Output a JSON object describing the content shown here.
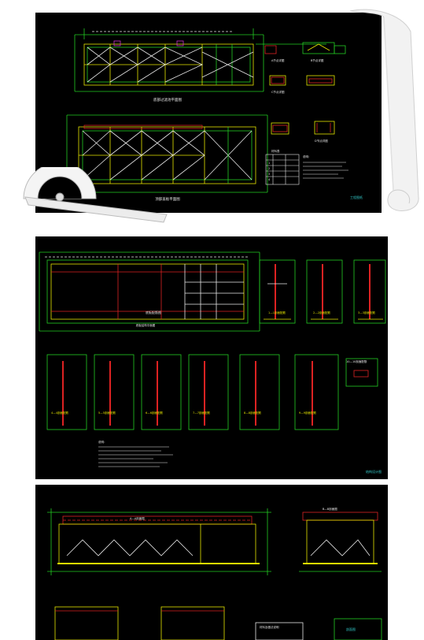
{
  "sheet1": {
    "plan_title_top": "底部过滤池平面图",
    "plan_title_bottom": "顶部盖板平面图",
    "table_title": "材料表",
    "table_rows": [
      "1",
      "2",
      "3",
      "4"
    ],
    "notes_title": "说明：",
    "detail_labels": [
      "A节点详图",
      "B节点详图",
      "C节点详图",
      "D节点详图"
    ],
    "stamp": "工程图纸"
  },
  "sheet2": {
    "plan_center_label": "底板配筋图",
    "plan_caption": "底板结构平面图",
    "sections_top": [
      "1—1剖面配筋",
      "2—2剖面配筋",
      "3—3剖面配筋"
    ],
    "sections_mid": [
      "4—4剖面配筋",
      "5—5剖面配筋",
      "6—6剖面配筋",
      "7—7剖面配筋",
      "8—8剖面配筋",
      "9—9剖面配筋"
    ],
    "small_detail": "10—10剖面配筋",
    "notes_title": "说明：",
    "stamp": "结构设计图"
  },
  "sheet3": {
    "section_a": "A—A剖面图",
    "section_b": "B—B剖面图",
    "legend": "材料及做法说明",
    "stamp": "剖面图"
  },
  "colors": {
    "paper": "#000000",
    "yellow": "#e6e600",
    "green": "#22cc22",
    "red": "#dd2222",
    "magenta": "#cc33cc",
    "cyan": "#33cccc",
    "white": "#e8e8e8"
  }
}
